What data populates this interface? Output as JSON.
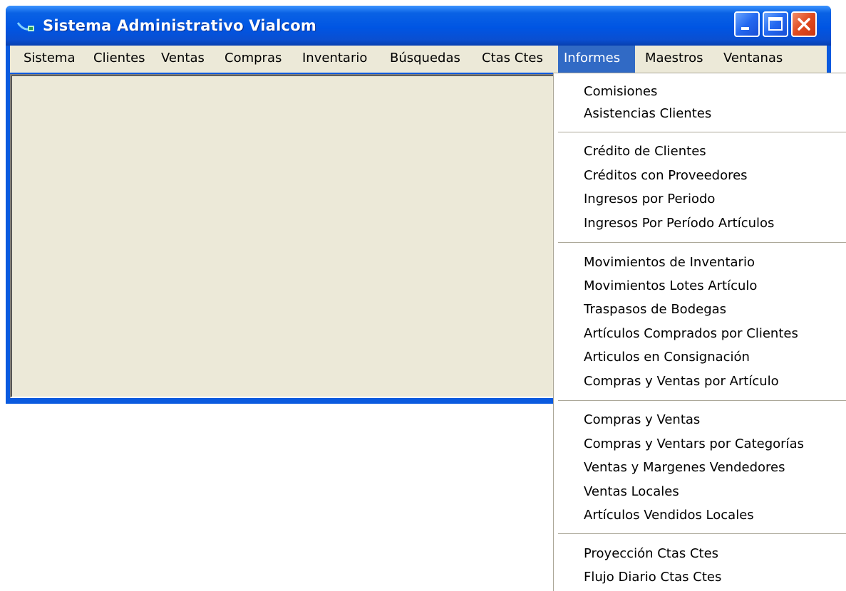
{
  "window": {
    "title": "Sistema Administrativo Vialcom",
    "icon": "vialcom-app-icon"
  },
  "menubar": {
    "items": [
      {
        "label": "Sistema"
      },
      {
        "label": "Clientes"
      },
      {
        "label": "Ventas"
      },
      {
        "label": "Compras"
      },
      {
        "label": "Inventario"
      },
      {
        "label": "Búsquedas"
      },
      {
        "label": "Ctas Ctes"
      },
      {
        "label": "Informes",
        "active": true
      },
      {
        "label": "Maestros"
      },
      {
        "label": "Ventanas"
      }
    ]
  },
  "informes_menu": {
    "groups": [
      [
        "Comisiones",
        "Asistencias Clientes"
      ],
      [
        "Crédito de Clientes",
        "Créditos con Proveedores",
        "Ingresos por Periodo",
        "Ingresos Por Período Artículos"
      ],
      [
        "Movimientos de Inventario",
        "Movimientos Lotes Artículo",
        "Traspasos de Bodegas",
        "Artículos Comprados por Clientes",
        "Articulos en Consignación",
        "Compras y Ventas por Artículo"
      ],
      [
        "Compras y Ventas",
        "Compras y Ventars por Categorías",
        "Ventas y Margenes Vendedores",
        "Ventas Locales",
        "Artículos Vendidos Locales"
      ],
      [
        "Proyección Ctas Ctes",
        "Flujo Diario Ctas Ctes"
      ]
    ]
  },
  "colors": {
    "titlebar": "#0055e3",
    "menu_highlight": "#316ac5",
    "face": "#ece9d8",
    "close_button": "#e04a1f"
  }
}
